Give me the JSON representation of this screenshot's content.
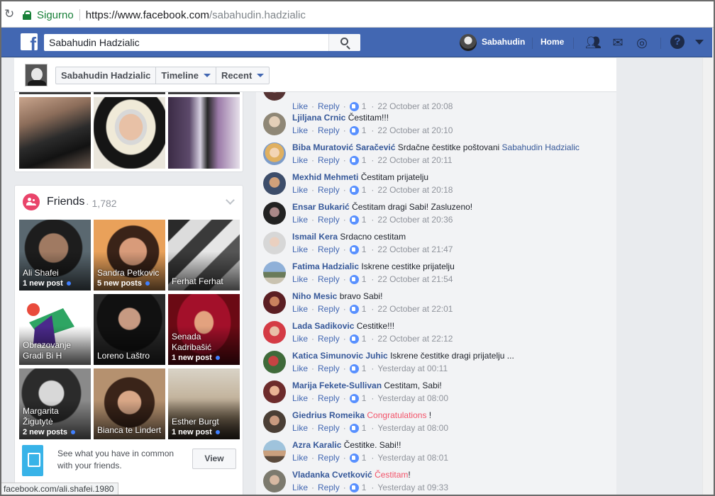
{
  "browser": {
    "secure_label": "Sigurno",
    "url_main": "https://www.facebook.com",
    "url_path": "/sabahudin.hadzialic"
  },
  "fb_bar": {
    "search_value": "Sabahudin Hadzialic",
    "user_name": "Sabahudin",
    "home_label": "Home",
    "help_label": "?",
    "brand_color": "#4267b2"
  },
  "page_header": {
    "name_tab": "Sabahudin Hadzialic",
    "timeline_tab": "Timeline",
    "recent_tab": "Recent"
  },
  "friends": {
    "title": "Friends",
    "count": "· 1,782",
    "tiles": [
      {
        "name": "Ali Shafei",
        "sub": "1 new post"
      },
      {
        "name": "Sandra Petkovic",
        "sub": "5 new posts"
      },
      {
        "name": "Ferhat Ferhat",
        "sub": ""
      },
      {
        "name": "Obrazovanje Gradi Bi H",
        "sub": ""
      },
      {
        "name": "Loreno Laštro",
        "sub": ""
      },
      {
        "name": "Senada Kadribašić",
        "sub": "1 new post"
      },
      {
        "name": "Margarita Žigutytė",
        "sub": "2 new posts"
      },
      {
        "name": "Bianca te Lindert",
        "sub": ""
      },
      {
        "name": "Esther Burgt",
        "sub": "1 new post"
      }
    ],
    "common_text": "See what you have in common with your friends.",
    "view_label": "View"
  },
  "status_bar": "facebook.com/ali.shafei.1980",
  "comments": [
    {
      "author": "",
      "text": "",
      "time": "22 October at 20:08",
      "likes": "1"
    },
    {
      "author": "Ljiljana Crnic",
      "text": "Čestitam!!!",
      "time": "22 October at 20:10",
      "likes": "1"
    },
    {
      "author": "Biba Muratović Saračević",
      "text": "Srdačne čestitke poštovani",
      "link": "Sabahudin Hadzialic",
      "time": "22 October at 20:11",
      "likes": "1"
    },
    {
      "author": "Mexhid Mehmeti",
      "text": "Čestitam prijatelju",
      "time": "22 October at 20:18",
      "likes": "1"
    },
    {
      "author": "Ensar Bukarić",
      "text": "Čestitam dragi Sabi! Zasluzeno!",
      "time": "22 October at 20:36",
      "likes": "1"
    },
    {
      "author": "Ismail Kera",
      "text": "Srdacno cestitam",
      "time": "22 October at 21:47",
      "likes": "1"
    },
    {
      "author": "Fatima Hadzialic",
      "text": "Iskrene cestitke prijatelju",
      "time": "22 October at 21:54",
      "likes": "1"
    },
    {
      "author": "Niho Mesic",
      "text": "bravo Sabi!",
      "time": "22 October at 22:01",
      "likes": "1"
    },
    {
      "author": "Lada Sadikovic",
      "text": "Cestitke!!!",
      "time": "22 October at 22:12",
      "likes": "1"
    },
    {
      "author": "Katica Simunovic Juhic",
      "text": "Iskrene čestitke dragi prijatelju ...",
      "time": "Yesterday at 00:11",
      "likes": "1"
    },
    {
      "author": "Marija Fekete-Sullivan",
      "text": "Cestitam, Sabi!",
      "time": "Yesterday at 08:00",
      "likes": "1"
    },
    {
      "author": "Giedrius Romeika",
      "red": "Congratulations",
      "after": " !",
      "time": "Yesterday at 08:00",
      "likes": "1"
    },
    {
      "author": "Azra Karalic",
      "text": "Čestitke. Sabi!!",
      "time": "Yesterday at 08:01",
      "likes": "1"
    },
    {
      "author": "Vladanka Cvetković",
      "red": "Čestitam",
      "after": "!",
      "time": "Yesterday at 09:33",
      "likes": "1"
    }
  ],
  "actions": {
    "like": "Like",
    "reply": "Reply",
    "dot": "·"
  }
}
